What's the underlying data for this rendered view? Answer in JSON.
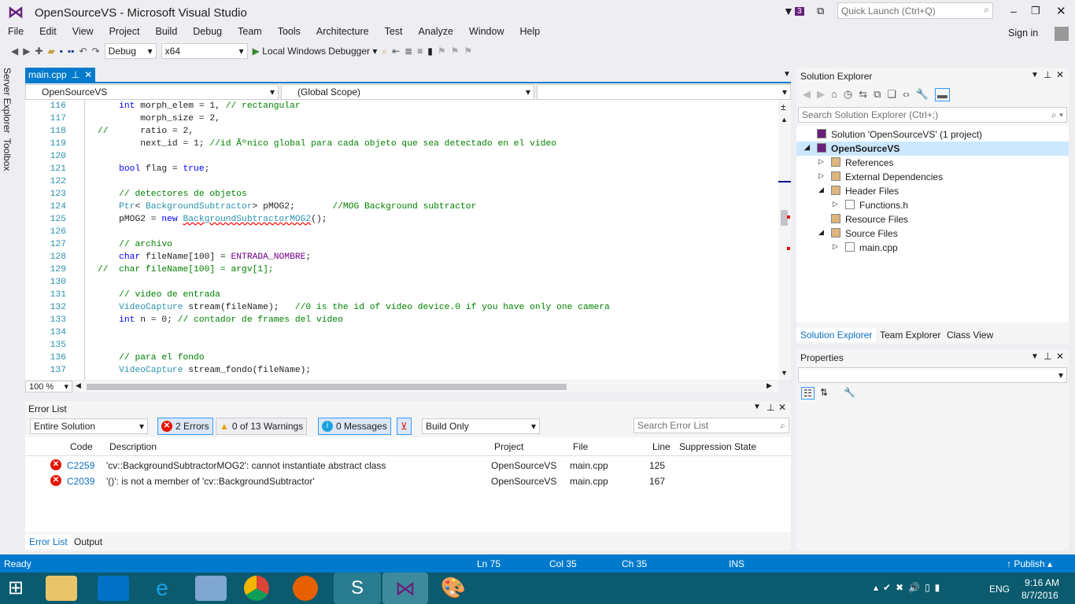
{
  "title": "OpenSourceVS - Microsoft Visual Studio",
  "notification_count": "3",
  "quick_launch_placeholder": "Quick Launch (Ctrl+Q)",
  "sign_in": "Sign in",
  "menu": [
    "File",
    "Edit",
    "View",
    "Project",
    "Build",
    "Debug",
    "Team",
    "Tools",
    "Architecture",
    "Test",
    "Analyze",
    "Window",
    "Help"
  ],
  "toolbar": {
    "config": "Debug",
    "platform": "x64",
    "debugger": "Local Windows Debugger"
  },
  "editor": {
    "tab": "main.cpp",
    "project_combo": "OpenSourceVS",
    "scope_combo": "(Global Scope)",
    "zoom": "100 %",
    "lines": [
      {
        "n": "116",
        "t": [
          [
            "",
            "    "
          ],
          [
            "kw",
            "int"
          ],
          [
            "",
            " morph_elem = 1, "
          ],
          [
            "cm",
            "// rectangular"
          ]
        ]
      },
      {
        "n": "117",
        "t": [
          [
            "",
            "        morph_size = 2,"
          ]
        ]
      },
      {
        "n": "118",
        "t": [
          [
            "cm",
            "//      "
          ],
          [
            "",
            "ratio = 2,"
          ]
        ]
      },
      {
        "n": "119",
        "t": [
          [
            "",
            "        next_id = 1; "
          ],
          [
            "cm",
            "//id Ãºnico global para cada objeto que sea detectado en el video"
          ]
        ]
      },
      {
        "n": "120",
        "t": []
      },
      {
        "n": "121",
        "t": [
          [
            "",
            "    "
          ],
          [
            "kw",
            "bool"
          ],
          [
            "",
            " flag = "
          ],
          [
            "kw",
            "true"
          ],
          [
            "",
            ";"
          ]
        ]
      },
      {
        "n": "122",
        "t": []
      },
      {
        "n": "123",
        "t": [
          [
            "",
            "    "
          ],
          [
            "cm",
            "// detectores de objetos"
          ]
        ]
      },
      {
        "n": "124",
        "t": [
          [
            "",
            "    "
          ],
          [
            "ty",
            "Ptr"
          ],
          [
            "",
            "< "
          ],
          [
            "ty",
            "BackgroundSubtractor"
          ],
          [
            "",
            "> pMOG2;       "
          ],
          [
            "cm",
            "//MOG Background subtractor"
          ]
        ]
      },
      {
        "n": "125",
        "t": [
          [
            "",
            "    pMOG2 = "
          ],
          [
            "kw",
            "new"
          ],
          [
            "",
            " "
          ],
          [
            "tyerr",
            "BackgroundSubtractorMOG2"
          ],
          [
            "",
            "();"
          ]
        ]
      },
      {
        "n": "126",
        "t": []
      },
      {
        "n": "127",
        "t": [
          [
            "",
            "    "
          ],
          [
            "cm",
            "// archivo"
          ]
        ]
      },
      {
        "n": "128",
        "t": [
          [
            "",
            "    "
          ],
          [
            "kw",
            "char"
          ],
          [
            "",
            " fileName[100] = "
          ],
          [
            "mc",
            "ENTRADA_NOMBRE"
          ],
          [
            "",
            ";"
          ]
        ]
      },
      {
        "n": "129",
        "t": [
          [
            "cm",
            "//  char fileName[100] = argv[1];"
          ]
        ]
      },
      {
        "n": "130",
        "t": []
      },
      {
        "n": "131",
        "t": [
          [
            "",
            "    "
          ],
          [
            "cm",
            "// video de entrada"
          ]
        ]
      },
      {
        "n": "132",
        "t": [
          [
            "",
            "    "
          ],
          [
            "ty",
            "VideoCapture"
          ],
          [
            "",
            " stream(fileName);   "
          ],
          [
            "cm",
            "//0 is the id of video device.0 if you have only one camera"
          ]
        ]
      },
      {
        "n": "133",
        "t": [
          [
            "",
            "    "
          ],
          [
            "kw",
            "int"
          ],
          [
            "",
            " n = 0; "
          ],
          [
            "cm",
            "// contador de frames del video"
          ]
        ]
      },
      {
        "n": "134",
        "t": []
      },
      {
        "n": "135",
        "t": []
      },
      {
        "n": "136",
        "t": [
          [
            "",
            "    "
          ],
          [
            "cm",
            "// para el fondo"
          ]
        ]
      },
      {
        "n": "137",
        "t": [
          [
            "",
            "    "
          ],
          [
            "ty",
            "VideoCapture"
          ],
          [
            "",
            " stream_fondo(fileName);"
          ]
        ]
      }
    ]
  },
  "side_tabs": [
    "Server Explorer",
    "Toolbox"
  ],
  "error_list": {
    "title": "Error List",
    "scope": "Entire Solution",
    "errors_btn": "2 Errors",
    "warnings_btn": "0 of 13 Warnings",
    "messages_btn": "0 Messages",
    "build_filter": "Build Only",
    "search_placeholder": "Search Error List",
    "columns": [
      "Code",
      "Description",
      "Project",
      "File",
      "Line",
      "Suppression State"
    ],
    "rows": [
      {
        "code": "C2259",
        "description": "'cv::BackgroundSubtractorMOG2': cannot instantiate abstract class",
        "project": "OpenSourceVS",
        "file": "main.cpp",
        "line": "125"
      },
      {
        "code": "C2039",
        "description": "'()': is not a member of 'cv::BackgroundSubtractor'",
        "project": "OpenSourceVS",
        "file": "main.cpp",
        "line": "167"
      }
    ],
    "bottom_tabs": [
      "Error List",
      "Output"
    ]
  },
  "solution_explorer": {
    "title": "Solution Explorer",
    "search_placeholder": "Search Solution Explorer (Ctrl+;)",
    "tree": [
      {
        "label": "Solution 'OpenSourceVS' (1 project)",
        "level": 0,
        "arrow": ""
      },
      {
        "label": "OpenSourceVS",
        "level": 0,
        "arrow": "◢",
        "bold": true
      },
      {
        "label": "References",
        "level": 1,
        "arrow": "▷"
      },
      {
        "label": "External Dependencies",
        "level": 1,
        "arrow": "▷"
      },
      {
        "label": "Header Files",
        "level": 1,
        "arrow": "◢"
      },
      {
        "label": "Functions.h",
        "level": 2,
        "arrow": "▷"
      },
      {
        "label": "Resource Files",
        "level": 1,
        "arrow": ""
      },
      {
        "label": "Source Files",
        "level": 1,
        "arrow": "◢"
      },
      {
        "label": "main.cpp",
        "level": 2,
        "arrow": "▷"
      }
    ],
    "tabs": [
      "Solution Explorer",
      "Team Explorer",
      "Class View"
    ]
  },
  "properties": {
    "title": "Properties"
  },
  "status": {
    "ready": "Ready",
    "ln": "Ln 75",
    "col": "Col 35",
    "ch": "Ch 35",
    "ins": "INS",
    "publish": "Publish"
  },
  "taskbar": {
    "lang": "ENG",
    "time": "9:16 AM",
    "date": "8/7/2016"
  },
  "colors": {
    "accent": "#007acc",
    "vs_purple": "#68217a",
    "error": "#e51400"
  }
}
